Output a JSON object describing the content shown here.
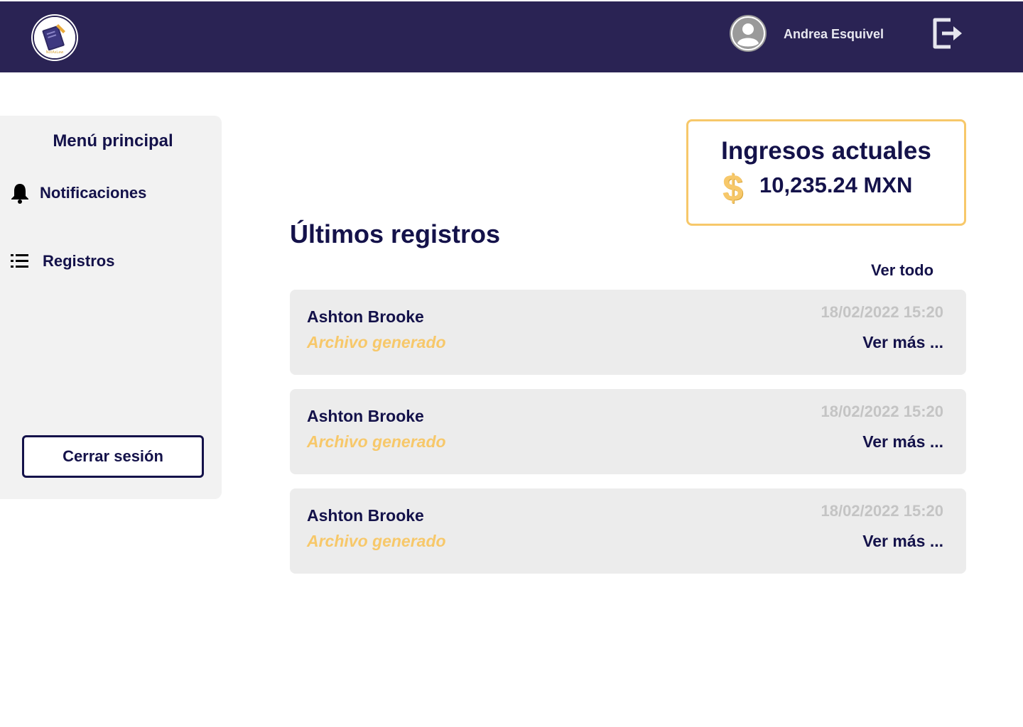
{
  "header": {
    "logo_icon": "book-logo-icon",
    "avatar_icon": "user-avatar-icon",
    "user_name": "Andrea Esquivel",
    "logout_icon": "logout-icon",
    "colors": {
      "bar": "#2a2354"
    }
  },
  "sidebar": {
    "title": "Menú principal",
    "items": [
      {
        "label": "Notificaciones",
        "icon": "bell-icon"
      },
      {
        "label": "Registros",
        "icon": "list-icon"
      }
    ],
    "logout_label": "Cerrar sesión"
  },
  "income": {
    "title": "Ingresos actuales",
    "currency_symbol": "$",
    "amount": "10,235.24 MXN",
    "accent": "#f7c86a"
  },
  "records": {
    "title": "Últimos registros",
    "see_all": "Ver todo",
    "items": [
      {
        "name": "Ashton Brooke",
        "status": "Archivo generado",
        "date": "18/02/2022 15:20",
        "more": "Ver más ..."
      },
      {
        "name": "Ashton Brooke",
        "status": "Archivo generado",
        "date": "18/02/2022 15:20",
        "more": "Ver más ..."
      },
      {
        "name": "Ashton Brooke",
        "status": "Archivo generado",
        "date": "18/02/2022 15:20",
        "more": "Ver más ..."
      }
    ]
  }
}
